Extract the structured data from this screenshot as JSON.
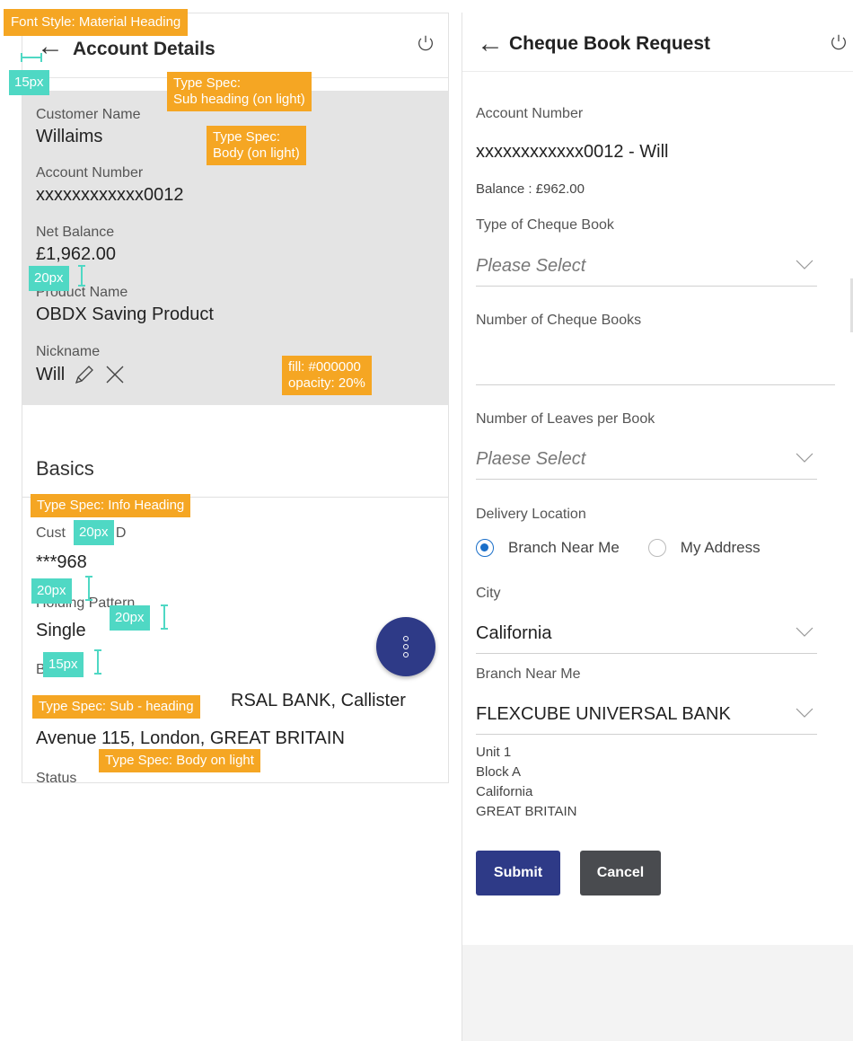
{
  "left": {
    "title": "Account Details",
    "fields": [
      {
        "label": "Customer Name",
        "value": "Willaims"
      },
      {
        "label": "Account Number",
        "value": "xxxxxxxxxxxx0012"
      },
      {
        "label": "Net Balance",
        "value": "£1,962.00"
      },
      {
        "label": "Product Name",
        "value": "OBDX Saving Product"
      }
    ],
    "nickname_label": "Nickname",
    "nickname_value": "Will",
    "basics_heading": "Basics",
    "basics": {
      "cust_id_label_visible": "Cust",
      "cust_id_label_tail": "D",
      "cust_id_value": "***968",
      "holding_label_visible": "Holding Pattern",
      "holding_value": "Single",
      "branch_label_visible": "B",
      "branch_value_line1_tail": "RSAL BANK, Callister",
      "branch_value_line2": "Avenue 115, London, GREAT BRITAIN",
      "status_label": "Status"
    }
  },
  "annotations": {
    "font_style": "Font Style: Material Heading",
    "sub_heading": "Type Spec:\nSub heading (on light)",
    "body": "Type Spec:\nBody (on light)",
    "fill": "fill: #000000\nopacity: 20%",
    "info_heading": "Type Spec: Info Heading",
    "sub_heading_2": "Type Spec: Sub - heading",
    "body_on_light": "Type Spec: Body on light",
    "m15a": "15px",
    "m20a": "20px",
    "m20b": "20px",
    "m20c": "20px",
    "m20d": "20px",
    "m15b": "15px"
  },
  "right": {
    "title": "Cheque Book Request",
    "account_number_label": "Account Number",
    "account_number_value": "xxxxxxxxxxxx0012 - Will",
    "balance": "Balance : £962.00",
    "cheque_type_label": "Type of Cheque Book",
    "cheque_type_placeholder": "Please Select",
    "num_books_label": "Number of Cheque Books",
    "leaves_label": "Number of Leaves per Book",
    "leaves_placeholder": "Plaese Select",
    "delivery_label": "Delivery Location",
    "radio_branch": "Branch Near Me",
    "radio_address": "My Address",
    "city_label": "City",
    "city_value": "California",
    "branch_label": "Branch Near Me",
    "branch_value": "FLEXCUBE UNIVERSAL BANK",
    "address_lines": [
      "Unit 1",
      "Block A",
      "California",
      "GREAT BRITAIN"
    ],
    "submit": "Submit",
    "cancel": "Cancel"
  }
}
